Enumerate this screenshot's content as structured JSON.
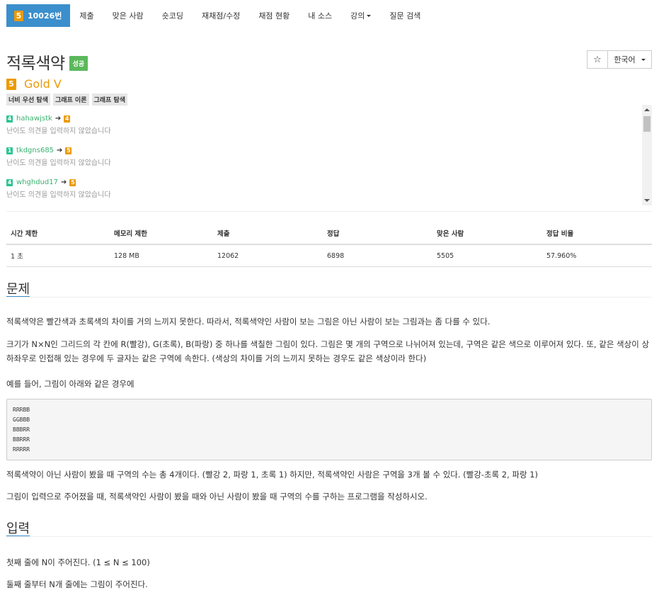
{
  "nav": {
    "problem_tier": "5",
    "problem_number": "10026번",
    "items": [
      "제출",
      "맞은 사람",
      "숏코딩",
      "재채점/수정",
      "채점 현황",
      "내 소스",
      "강의",
      "질문 검색"
    ]
  },
  "problem": {
    "title": "적록색약",
    "result_badge": "성공",
    "star": "☆",
    "language": "한국어",
    "tier_level": "5",
    "tier_name": "Gold V",
    "tags": [
      "너비 우선 탐색",
      "그래프 이론",
      "그래프 탐색"
    ]
  },
  "opinions": [
    {
      "from_tier": "4",
      "user": "hahawjstk",
      "to_tier": "4",
      "text": "난이도 의견을 입력하지 않았습니다"
    },
    {
      "from_tier": "1",
      "user": "tkdgns685",
      "to_tier": "5",
      "text": "난이도 의견을 입력하지 않았습니다"
    },
    {
      "from_tier": "4",
      "user": "whghdud17",
      "to_tier": "5",
      "text": "난이도 의견을 입력하지 않았습니다"
    }
  ],
  "stats": {
    "headers": [
      "시간 제한",
      "메모리 제한",
      "제출",
      "정답",
      "맞은 사람",
      "정답 비율"
    ],
    "values": [
      "1 초",
      "128 MB",
      "12062",
      "6898",
      "5505",
      "57.960%"
    ]
  },
  "description": {
    "heading": "문제",
    "p1": "적록색약은 빨간색과 초록색의 차이를 거의 느끼지 못한다. 따라서, 적록색약인 사람이 보는 그림은 아닌 사람이 보는 그림과는 좀 다를 수 있다.",
    "p2": "크기가 N×N인 그리드의 각 칸에 R(빨강), G(초록), B(파랑) 중 하나를 색칠한 그림이 있다. 그림은 몇 개의 구역으로 나뉘어져 있는데, 구역은 같은 색으로 이루어져 있다. 또, 같은 색상이 상하좌우로 인접해 있는 경우에 두 글자는 같은 구역에 속한다. (색상의 차이를 거의 느끼지 못하는 경우도 같은 색상이라 한다)",
    "p3": "예를 들어, 그림이 아래와 같은 경우에",
    "sample": "RRRBB\nGGBBB\nBBBRR\nBBRRR\nRRRRR",
    "p4": "적록색약이 아닌 사람이 봤을 때 구역의 수는 총 4개이다. (빨강 2, 파랑 1, 초록 1) 하지만, 적록색약인 사람은 구역을 3개 볼 수 있다. (빨강-초록 2, 파랑 1)",
    "p5": "그림이 입력으로 주어졌을 때, 적록색약인 사람이 봤을 때와 아닌 사람이 봤을 때 구역의 수를 구하는 프로그램을 작성하시오."
  },
  "input": {
    "heading": "입력",
    "p1": "첫째 줄에 N이 주어진다. (1 ≤ N ≤ 100)",
    "p2": "둘째 줄부터 N개 줄에는 그림이 주어진다."
  },
  "colors": {
    "accent": "#3b8fcc",
    "success": "#5cb85c",
    "gold": "#ec9a00",
    "silver": "#2bc58f"
  }
}
